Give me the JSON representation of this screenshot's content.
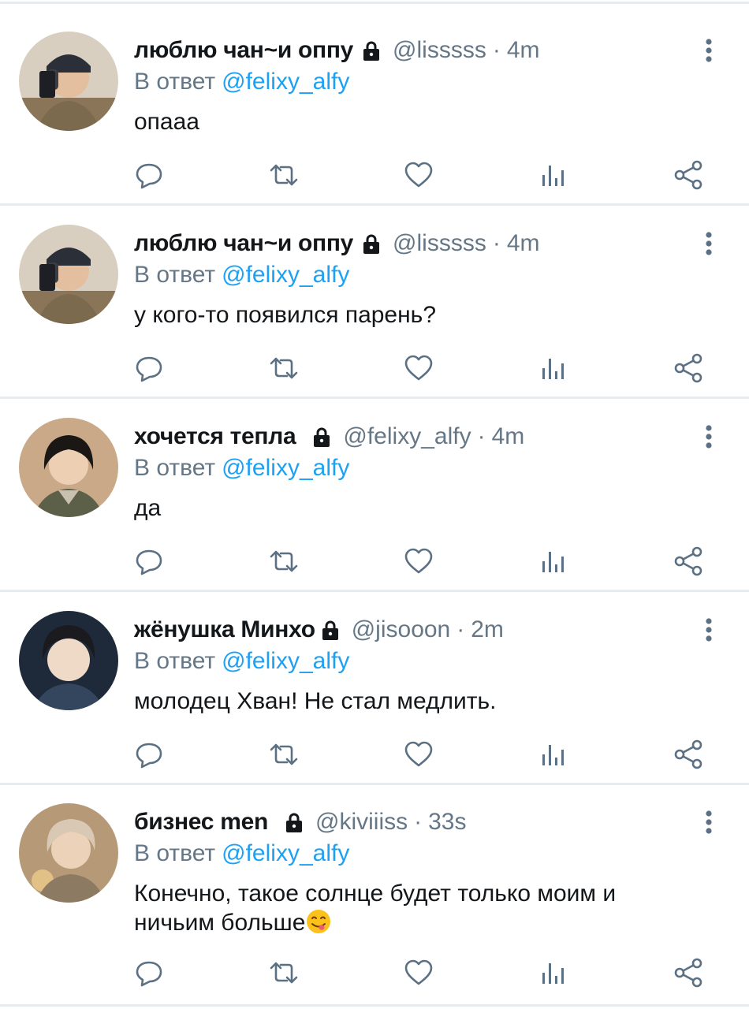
{
  "reply_prefix": "В ответ",
  "colors": {
    "text": "#14171a",
    "secondary": "#657786",
    "accent": "#1da1f2",
    "divider": "#e6ecf0",
    "icon": "#5b7083"
  },
  "action_icons": [
    "reply-icon",
    "retweet-icon",
    "like-icon",
    "analytics-icon",
    "share-icon"
  ],
  "tweets": [
    {
      "display_name": "люблю чан~и оппу",
      "handle": "@lisssss",
      "separator": "·",
      "time": "4m",
      "reply_to": "@felixy_alfy",
      "text": "опааа",
      "avatar": "avatar-photo"
    },
    {
      "display_name": "люблю чан~и оппу",
      "handle": "@lisssss",
      "separator": "·",
      "time": "4m",
      "reply_to": "@felixy_alfy",
      "text": "у кого-то появился парень?",
      "avatar": "avatar-photo"
    },
    {
      "display_name": "хочется тепла",
      "handle": "@felixy_alfy",
      "separator": "·",
      "time": "4m",
      "reply_to": "@felixy_alfy",
      "text": "да",
      "avatar": "avatar-photo"
    },
    {
      "display_name": "жёнушка Минхо",
      "handle": "@jisooon",
      "separator": "·",
      "time": "2m",
      "reply_to": "@felixy_alfy",
      "text": "молодец Хван! Не стал медлить.",
      "avatar": "avatar-photo"
    },
    {
      "display_name": "бизнес men",
      "handle": "@kiviiiss",
      "separator": "·",
      "time": "33s",
      "reply_to": "@felixy_alfy",
      "text": "Конечно, такое солнце будет только моим и ничьим больше",
      "emoji": "face-savoring-food-emoji",
      "avatar": "avatar-photo"
    }
  ]
}
